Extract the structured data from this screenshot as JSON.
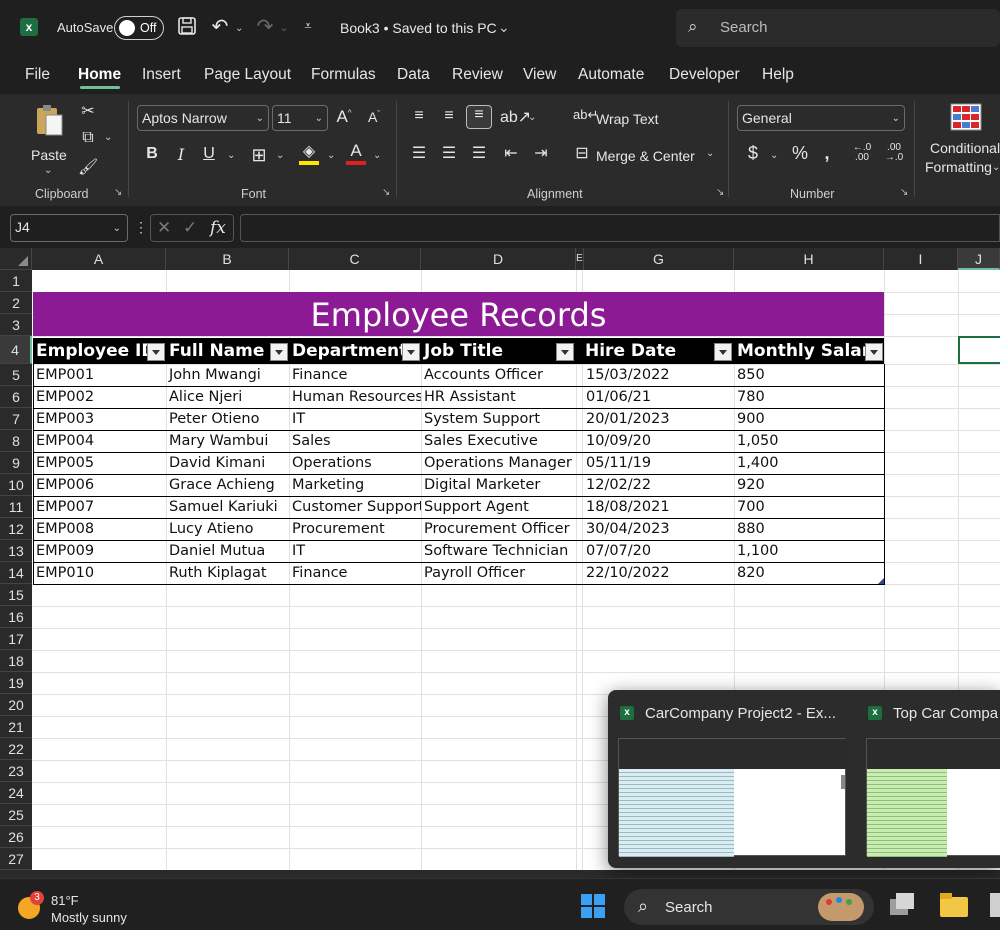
{
  "titlebar": {
    "autosave_label": "AutoSave",
    "autosave_state": "Off",
    "doc_title": "Book3 • Saved to this PC",
    "search_placeholder": "Search"
  },
  "menu": [
    "File",
    "Home",
    "Insert",
    "Page Layout",
    "Formulas",
    "Data",
    "Review",
    "View",
    "Automate",
    "Developer",
    "Help"
  ],
  "ribbon": {
    "clipboard": {
      "paste": "Paste",
      "group": "Clipboard"
    },
    "font": {
      "name": "Aptos Narrow",
      "size": "11",
      "group": "Font"
    },
    "alignment": {
      "wrap": "Wrap Text",
      "merge": "Merge & Center",
      "group": "Alignment"
    },
    "number": {
      "format": "General",
      "group": "Number"
    },
    "styles": {
      "conditional_line1": "Conditional",
      "conditional_line2": "Formatting"
    }
  },
  "formula_bar": {
    "name_box": "J4",
    "fx": "fx",
    "value": ""
  },
  "columns": [
    "A",
    "B",
    "C",
    "D",
    "E",
    "G",
    "H",
    "I",
    "J"
  ],
  "rows": [
    "1",
    "2",
    "3",
    "4",
    "5",
    "6",
    "7",
    "8",
    "9",
    "10",
    "11",
    "12",
    "13",
    "14",
    "15",
    "16",
    "17",
    "18",
    "19",
    "20",
    "21",
    "22",
    "23",
    "24",
    "25",
    "26",
    "27"
  ],
  "table": {
    "title": "Employee Records",
    "title_bg": "#8b1a94",
    "headers": [
      "Employee ID",
      "Full Name",
      "Department",
      "Job Title",
      "Hire Date",
      "Monthly Salary"
    ],
    "rows": [
      [
        "EMP001",
        "John Mwangi",
        "Finance",
        "Accounts Officer",
        "15/03/2022",
        "850"
      ],
      [
        "EMP002",
        "Alice Njeri",
        "Human Resources",
        "HR Assistant",
        "01/06/21",
        "780"
      ],
      [
        "EMP003",
        "Peter Otieno",
        "IT",
        "System Support",
        "20/01/2023",
        "900"
      ],
      [
        "EMP004",
        "Mary Wambui",
        "Sales",
        "Sales Executive",
        "10/09/20",
        "1,050"
      ],
      [
        "EMP005",
        "David Kimani",
        "Operations",
        "Operations Manager",
        "05/11/19",
        "1,400"
      ],
      [
        "EMP006",
        "Grace Achieng",
        "Marketing",
        "Digital Marketer",
        "12/02/22",
        "920"
      ],
      [
        "EMP007",
        "Samuel Kariuki",
        "Customer Support",
        "Support Agent",
        "18/08/2021",
        "700"
      ],
      [
        "EMP008",
        "Lucy Atieno",
        "Procurement",
        "Procurement Officer",
        "30/04/2023",
        "880"
      ],
      [
        "EMP009",
        "Daniel Mutua",
        "IT",
        "Software Technician",
        "07/07/20",
        "1,100"
      ],
      [
        "EMP010",
        "Ruth Kiplagat",
        "Finance",
        "Payroll Officer",
        "22/10/2022",
        "820"
      ]
    ]
  },
  "popup": {
    "item1": "CarCompany Project2 - Ex...",
    "item2": "Top Car Compa"
  },
  "taskbar": {
    "weather_badge": "3",
    "temp": "81°F",
    "condition": "Mostly sunny",
    "search": "Search"
  },
  "colors": {
    "accent": "#6fc09a",
    "excel_green": "#1d6f42",
    "title_purple": "#8b1a94"
  }
}
